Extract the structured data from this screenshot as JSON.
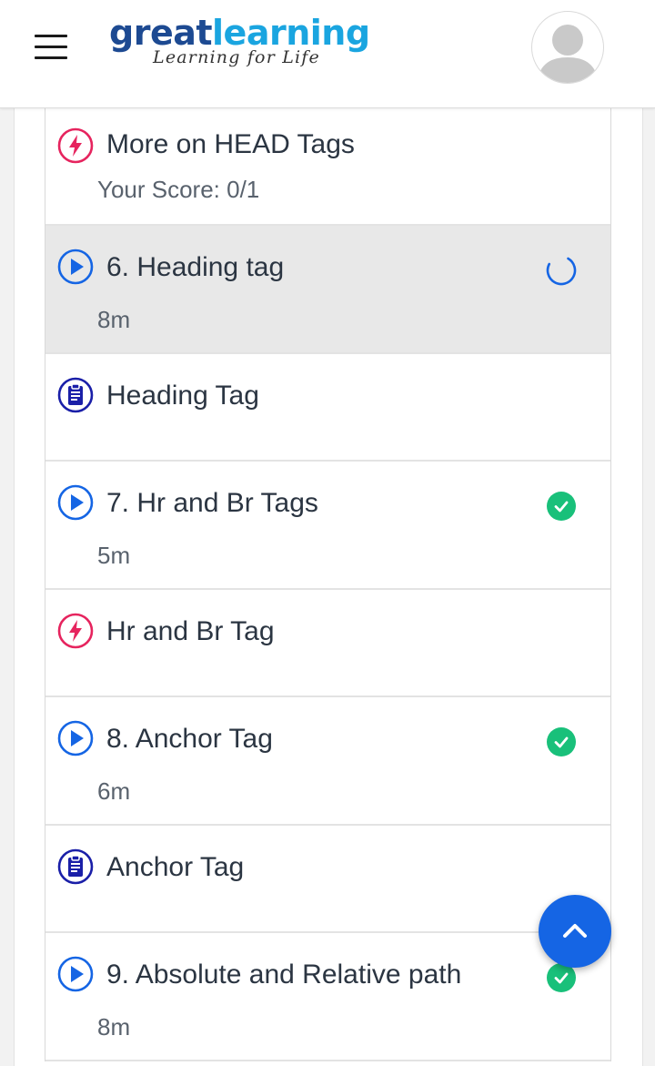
{
  "header": {
    "logo_great": "great",
    "logo_learning": "learning",
    "logo_tagline": "Learning for Life"
  },
  "items": [
    {
      "type": "quiz",
      "title": "More on HEAD Tags",
      "sub": "Your Score: 0/1",
      "status": "none"
    },
    {
      "type": "video",
      "title": "6. Heading tag",
      "sub": "8m",
      "status": "in-progress"
    },
    {
      "type": "notes",
      "title": "Heading Tag",
      "sub": "",
      "status": "none"
    },
    {
      "type": "video",
      "title": "7. Hr and Br Tags",
      "sub": "5m",
      "status": "complete"
    },
    {
      "type": "quiz",
      "title": "Hr and Br Tag",
      "sub": "",
      "status": "none"
    },
    {
      "type": "video",
      "title": "8. Anchor Tag",
      "sub": "6m",
      "status": "complete"
    },
    {
      "type": "notes",
      "title": "Anchor Tag",
      "sub": "",
      "status": "none"
    },
    {
      "type": "video",
      "title": "9. Absolute and Relative path",
      "sub": "8m",
      "status": "complete"
    }
  ],
  "colors": {
    "quiz": "#e6245e",
    "video": "#1565e4",
    "notes": "#1a1fa8",
    "complete": "#19c07a",
    "spinner": "#1565e4",
    "fab": "#1565e4"
  },
  "icons": {
    "quiz": "flash-icon",
    "video": "play-circle-icon",
    "notes": "clipboard-icon",
    "complete": "check-circle-icon",
    "in_progress": "spinner-icon",
    "fab": "chevron-up-icon"
  }
}
